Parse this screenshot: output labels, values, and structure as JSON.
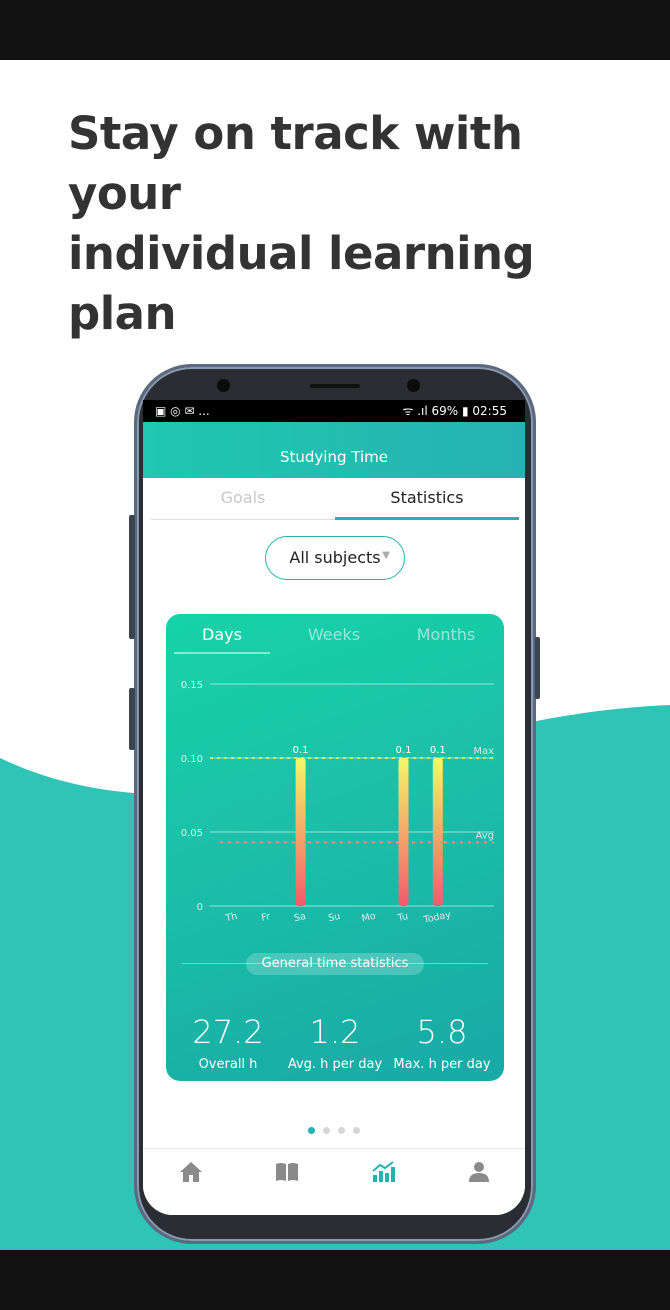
{
  "headline": {
    "line1": "Stay on track with your",
    "line2": "individual learning plan"
  },
  "colors": {
    "accent": "#26b2b2",
    "wave": "#2fc4b6",
    "bar_top": "#f4f76a",
    "bar_bottom": "#f45a6c"
  },
  "statusbar": {
    "left": "▣ ◎ ✉ ...",
    "right": "ᯤ .ıl 69% ▮ 02:55"
  },
  "app": {
    "title": "Studying Time"
  },
  "tabs": {
    "goals": "Goals",
    "statistics": "Statistics"
  },
  "subject_filter": {
    "value": "All subjects"
  },
  "period_tabs": {
    "days": "Days",
    "weeks": "Weeks",
    "months": "Months"
  },
  "chart_data": {
    "type": "bar",
    "categories": [
      "Th",
      "Fr",
      "Sa",
      "Su",
      "Mo",
      "Tu",
      "Today"
    ],
    "values": [
      0,
      0,
      0.1,
      0,
      0,
      0.1,
      0.1
    ],
    "data_labels": [
      "",
      "",
      "0.1",
      "",
      "",
      "0.1",
      "0.1"
    ],
    "yticks": [
      "0",
      "0.05",
      "0.10",
      "0.15"
    ],
    "ytick_values": [
      0,
      0.05,
      0.1,
      0.15
    ],
    "ylim": [
      0,
      0.15
    ],
    "max_line": {
      "label": "Max",
      "value": 0.1
    },
    "avg_line": {
      "label": "Avg",
      "value": 0.043
    },
    "grid": true
  },
  "general_stats": {
    "label": "General time statistics",
    "overall": {
      "value": "27.2",
      "label": "Overall h"
    },
    "avg": {
      "value": "1.2",
      "label": "Avg. h per day"
    },
    "max": {
      "value": "5.8",
      "label": "Max. h per day"
    }
  },
  "pager": {
    "count": 4,
    "active": 0
  },
  "nav": {
    "icons": [
      "home-icon",
      "book-icon",
      "chart-icon",
      "profile-icon"
    ],
    "active": 2
  }
}
